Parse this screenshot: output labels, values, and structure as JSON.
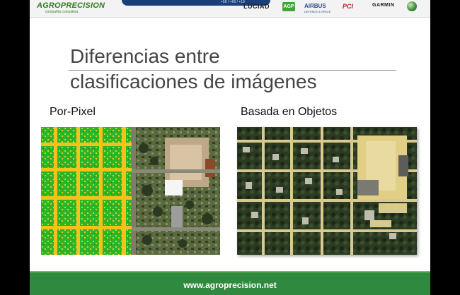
{
  "header": {
    "logo_name": "AGROPRECISION",
    "logo_tagline": "compañía consultora",
    "band_text": "+56 / +66 / +19",
    "partners": {
      "luciad": "LUCIAD",
      "agp": "AGP",
      "airbus": "AIRBUS",
      "airbus_sub": "DEFENCE & SPACE",
      "pci": "PCI",
      "garmin": "GARMIN"
    }
  },
  "slide": {
    "title_line1": "Diferencias entre",
    "title_line2": "clasificaciones de imágenes",
    "label_left": "Por-Pixel",
    "label_right": "Basada en Objetos"
  },
  "footer": {
    "url": "www.agroprecision.net"
  },
  "colors": {
    "footer_green": "#2f8a3f",
    "logo_green": "#2e7d1e",
    "band_blue": "#1c3f7a"
  }
}
